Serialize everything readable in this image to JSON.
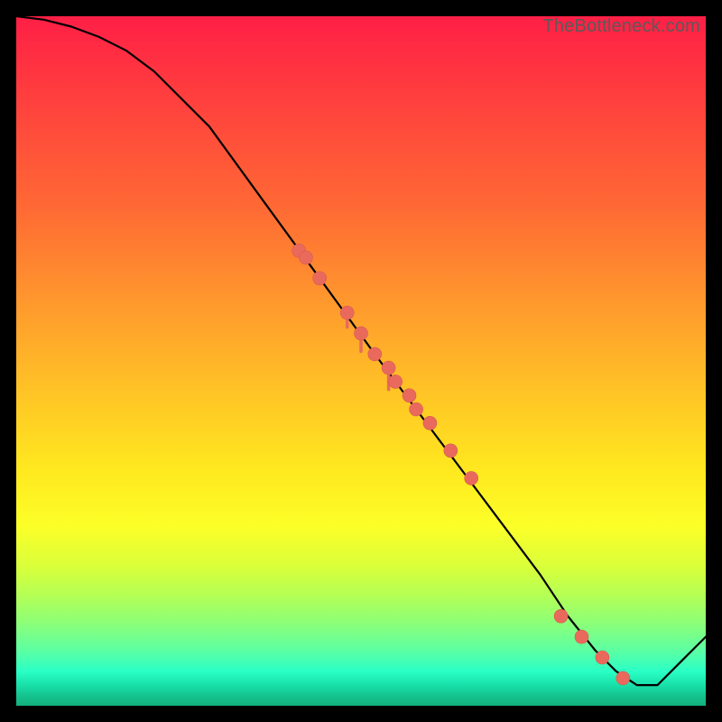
{
  "attribution": "TheBottleneck.com",
  "colors": {
    "dot": "#e96a5d",
    "curve": "#000000",
    "gradient_top": "#ff1f46",
    "gradient_mid": "#ffe91f",
    "gradient_bottom": "#13b07e"
  },
  "chart_data": {
    "type": "line",
    "title": "",
    "xlabel": "",
    "ylabel": "",
    "xlim": [
      0,
      100
    ],
    "ylim": [
      0,
      100
    ],
    "note": "Axes unlabeled; values are estimated percentages of plot width/height. y is distance from bottom (higher = closer to top).",
    "series": [
      {
        "name": "curve",
        "x": [
          0,
          4,
          8,
          12,
          16,
          20,
          28,
          36,
          44,
          52,
          58,
          64,
          70,
          76,
          80,
          84,
          87,
          90,
          93,
          96,
          100
        ],
        "y": [
          100,
          99.5,
          98.5,
          97,
          95,
          92,
          84,
          73,
          62,
          51,
          43,
          35,
          27,
          19,
          13,
          8,
          5,
          3,
          3,
          6,
          10
        ]
      }
    ],
    "scatter_points": {
      "name": "highlighted-points-on-curve",
      "x": [
        41,
        42,
        44,
        48,
        50,
        52,
        54,
        55,
        57,
        58,
        60,
        63,
        66,
        79,
        82,
        85,
        88
      ],
      "y": [
        66,
        65,
        62,
        57,
        54,
        51,
        49,
        47,
        45,
        43,
        41,
        37,
        33,
        13,
        10,
        7,
        4
      ]
    }
  }
}
